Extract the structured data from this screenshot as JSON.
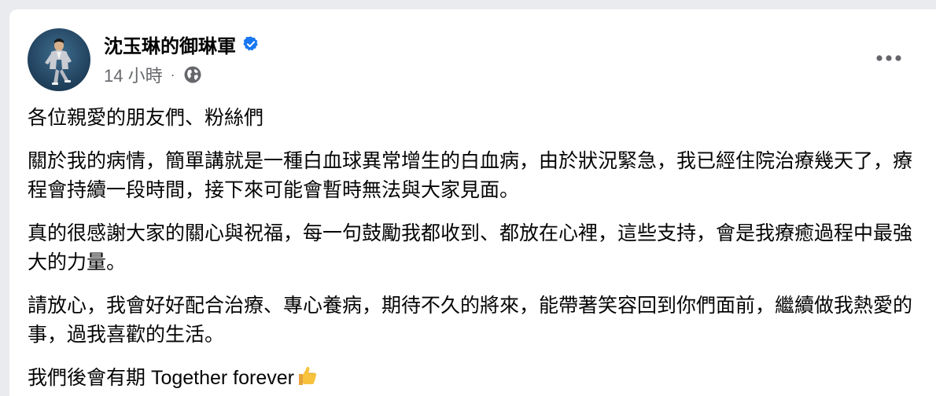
{
  "post": {
    "author": "沈玉琳的御琳軍",
    "timestamp": "14 小時",
    "separator": "·",
    "paragraphs": [
      "各位親愛的朋友們、粉絲們",
      "關於我的病情，簡單講就是一種白血球異常增生的白血病，由於狀況緊急，我已經住院治療幾天了，療程會持續一段時間，接下來可能會暫時無法與大家見面。",
      "真的很感謝大家的關心與祝福，每一句鼓勵我都收到、都放在心裡，這些支持，會是我療癒過程中最強大的力量。",
      "請放心，我會好好配合治療、專心養病，期待不久的將來，能帶著笑容回到你們面前，繼續做我熱愛的事，過我喜歡的生活。"
    ],
    "closing": "我們後會有期  Together forever"
  },
  "icons": {
    "verified": "verified-badge-icon",
    "audience": "globe-icon",
    "more": "more-options-icon",
    "emoji": "thumbs-up-emoji"
  },
  "colors": {
    "verified_blue": "#1877f2",
    "secondary_text": "#65676b",
    "primary_text": "#050505"
  }
}
